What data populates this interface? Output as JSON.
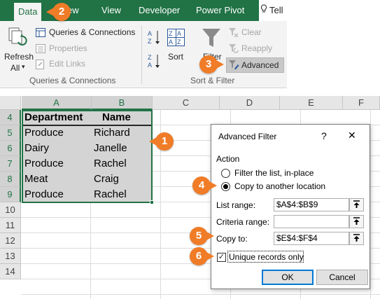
{
  "ribbon": {
    "tabs": {
      "data": "Data",
      "view_partial": "ew",
      "view": "View",
      "developer": "Developer",
      "power_pivot": "Power Pivot",
      "tell": "Tell"
    },
    "refresh": {
      "line1": "Refresh",
      "line2": "All",
      "arrow": "▾"
    },
    "queries": {
      "queries_connections": "Queries & Connections",
      "properties": "Properties",
      "edit_links": "Edit Links",
      "group_label": "Queries & Connections"
    },
    "sort": {
      "sort_label": "Sort",
      "filter_label": "Filter"
    },
    "filter_group": {
      "clear": "Clear",
      "reapply": "Reapply",
      "advanced": "Advanced",
      "group_label": "Sort & Filter"
    }
  },
  "sheet": {
    "columns": [
      "A",
      "B",
      "C",
      "D",
      "E",
      "F"
    ],
    "rows": [
      "4",
      "5",
      "6",
      "7",
      "8",
      "9",
      "10",
      "11",
      "12",
      "13",
      "14"
    ],
    "header": {
      "department": "Department",
      "name": "Name"
    },
    "data": [
      {
        "department": "Produce",
        "name": "Richard"
      },
      {
        "department": "Dairy",
        "name": "Janelle"
      },
      {
        "department": "Produce",
        "name": "Rachel"
      },
      {
        "department": "Meat",
        "name": "Craig"
      },
      {
        "department": "Produce",
        "name": "Rachel"
      }
    ]
  },
  "dialog": {
    "title": "Advanced Filter",
    "help": "?",
    "close": "✕",
    "action_label": "Action",
    "option_filter_in_place": "Filter the list, in-place",
    "option_copy": "Copy to another location",
    "list_range_label": "List range:",
    "list_range_value": "$A$4:$B$9",
    "criteria_range_label": "Criteria range:",
    "criteria_range_value": "",
    "copy_to_label": "Copy to:",
    "copy_to_value": "$E$4:$F$4",
    "unique_label": "Unique records only",
    "unique_checked": "✓",
    "ok": "OK",
    "cancel": "Cancel"
  },
  "markers": {
    "m1": "1",
    "m2": "2",
    "m3": "3",
    "m4": "4",
    "m5": "5",
    "m6": "6"
  },
  "colors": {
    "excel_green": "#217346",
    "marker_orange": "#f07c27",
    "selection_gray": "#d4d4d4"
  }
}
